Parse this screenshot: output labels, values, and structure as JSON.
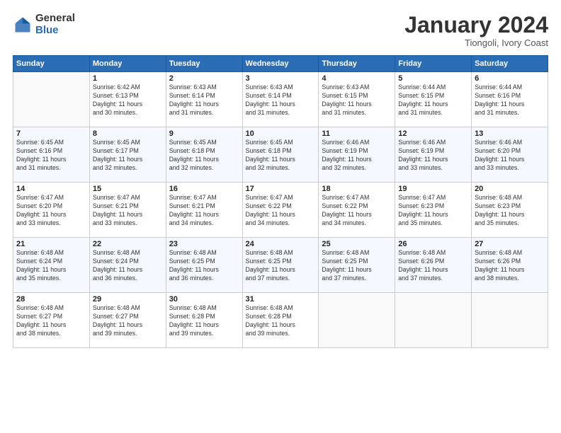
{
  "logo": {
    "general": "General",
    "blue": "Blue"
  },
  "title": "January 2024",
  "subtitle": "Tiongoli, Ivory Coast",
  "days_of_week": [
    "Sunday",
    "Monday",
    "Tuesday",
    "Wednesday",
    "Thursday",
    "Friday",
    "Saturday"
  ],
  "weeks": [
    [
      {
        "day": "",
        "sunrise": "",
        "sunset": "",
        "daylight": ""
      },
      {
        "day": "1",
        "sunrise": "Sunrise: 6:42 AM",
        "sunset": "Sunset: 6:13 PM",
        "daylight": "Daylight: 11 hours and 30 minutes."
      },
      {
        "day": "2",
        "sunrise": "Sunrise: 6:43 AM",
        "sunset": "Sunset: 6:14 PM",
        "daylight": "Daylight: 11 hours and 31 minutes."
      },
      {
        "day": "3",
        "sunrise": "Sunrise: 6:43 AM",
        "sunset": "Sunset: 6:14 PM",
        "daylight": "Daylight: 11 hours and 31 minutes."
      },
      {
        "day": "4",
        "sunrise": "Sunrise: 6:43 AM",
        "sunset": "Sunset: 6:15 PM",
        "daylight": "Daylight: 11 hours and 31 minutes."
      },
      {
        "day": "5",
        "sunrise": "Sunrise: 6:44 AM",
        "sunset": "Sunset: 6:15 PM",
        "daylight": "Daylight: 11 hours and 31 minutes."
      },
      {
        "day": "6",
        "sunrise": "Sunrise: 6:44 AM",
        "sunset": "Sunset: 6:16 PM",
        "daylight": "Daylight: 11 hours and 31 minutes."
      }
    ],
    [
      {
        "day": "7",
        "sunrise": "Sunrise: 6:45 AM",
        "sunset": "Sunset: 6:16 PM",
        "daylight": "Daylight: 11 hours and 31 minutes."
      },
      {
        "day": "8",
        "sunrise": "Sunrise: 6:45 AM",
        "sunset": "Sunset: 6:17 PM",
        "daylight": "Daylight: 11 hours and 32 minutes."
      },
      {
        "day": "9",
        "sunrise": "Sunrise: 6:45 AM",
        "sunset": "Sunset: 6:18 PM",
        "daylight": "Daylight: 11 hours and 32 minutes."
      },
      {
        "day": "10",
        "sunrise": "Sunrise: 6:45 AM",
        "sunset": "Sunset: 6:18 PM",
        "daylight": "Daylight: 11 hours and 32 minutes."
      },
      {
        "day": "11",
        "sunrise": "Sunrise: 6:46 AM",
        "sunset": "Sunset: 6:19 PM",
        "daylight": "Daylight: 11 hours and 32 minutes."
      },
      {
        "day": "12",
        "sunrise": "Sunrise: 6:46 AM",
        "sunset": "Sunset: 6:19 PM",
        "daylight": "Daylight: 11 hours and 33 minutes."
      },
      {
        "day": "13",
        "sunrise": "Sunrise: 6:46 AM",
        "sunset": "Sunset: 6:20 PM",
        "daylight": "Daylight: 11 hours and 33 minutes."
      }
    ],
    [
      {
        "day": "14",
        "sunrise": "Sunrise: 6:47 AM",
        "sunset": "Sunset: 6:20 PM",
        "daylight": "Daylight: 11 hours and 33 minutes."
      },
      {
        "day": "15",
        "sunrise": "Sunrise: 6:47 AM",
        "sunset": "Sunset: 6:21 PM",
        "daylight": "Daylight: 11 hours and 33 minutes."
      },
      {
        "day": "16",
        "sunrise": "Sunrise: 6:47 AM",
        "sunset": "Sunset: 6:21 PM",
        "daylight": "Daylight: 11 hours and 34 minutes."
      },
      {
        "day": "17",
        "sunrise": "Sunrise: 6:47 AM",
        "sunset": "Sunset: 6:22 PM",
        "daylight": "Daylight: 11 hours and 34 minutes."
      },
      {
        "day": "18",
        "sunrise": "Sunrise: 6:47 AM",
        "sunset": "Sunset: 6:22 PM",
        "daylight": "Daylight: 11 hours and 34 minutes."
      },
      {
        "day": "19",
        "sunrise": "Sunrise: 6:47 AM",
        "sunset": "Sunset: 6:23 PM",
        "daylight": "Daylight: 11 hours and 35 minutes."
      },
      {
        "day": "20",
        "sunrise": "Sunrise: 6:48 AM",
        "sunset": "Sunset: 6:23 PM",
        "daylight": "Daylight: 11 hours and 35 minutes."
      }
    ],
    [
      {
        "day": "21",
        "sunrise": "Sunrise: 6:48 AM",
        "sunset": "Sunset: 6:24 PM",
        "daylight": "Daylight: 11 hours and 35 minutes."
      },
      {
        "day": "22",
        "sunrise": "Sunrise: 6:48 AM",
        "sunset": "Sunset: 6:24 PM",
        "daylight": "Daylight: 11 hours and 36 minutes."
      },
      {
        "day": "23",
        "sunrise": "Sunrise: 6:48 AM",
        "sunset": "Sunset: 6:25 PM",
        "daylight": "Daylight: 11 hours and 36 minutes."
      },
      {
        "day": "24",
        "sunrise": "Sunrise: 6:48 AM",
        "sunset": "Sunset: 6:25 PM",
        "daylight": "Daylight: 11 hours and 37 minutes."
      },
      {
        "day": "25",
        "sunrise": "Sunrise: 6:48 AM",
        "sunset": "Sunset: 6:25 PM",
        "daylight": "Daylight: 11 hours and 37 minutes."
      },
      {
        "day": "26",
        "sunrise": "Sunrise: 6:48 AM",
        "sunset": "Sunset: 6:26 PM",
        "daylight": "Daylight: 11 hours and 37 minutes."
      },
      {
        "day": "27",
        "sunrise": "Sunrise: 6:48 AM",
        "sunset": "Sunset: 6:26 PM",
        "daylight": "Daylight: 11 hours and 38 minutes."
      }
    ],
    [
      {
        "day": "28",
        "sunrise": "Sunrise: 6:48 AM",
        "sunset": "Sunset: 6:27 PM",
        "daylight": "Daylight: 11 hours and 38 minutes."
      },
      {
        "day": "29",
        "sunrise": "Sunrise: 6:48 AM",
        "sunset": "Sunset: 6:27 PM",
        "daylight": "Daylight: 11 hours and 39 minutes."
      },
      {
        "day": "30",
        "sunrise": "Sunrise: 6:48 AM",
        "sunset": "Sunset: 6:28 PM",
        "daylight": "Daylight: 11 hours and 39 minutes."
      },
      {
        "day": "31",
        "sunrise": "Sunrise: 6:48 AM",
        "sunset": "Sunset: 6:28 PM",
        "daylight": "Daylight: 11 hours and 39 minutes."
      },
      {
        "day": "",
        "sunrise": "",
        "sunset": "",
        "daylight": ""
      },
      {
        "day": "",
        "sunrise": "",
        "sunset": "",
        "daylight": ""
      },
      {
        "day": "",
        "sunrise": "",
        "sunset": "",
        "daylight": ""
      }
    ]
  ]
}
